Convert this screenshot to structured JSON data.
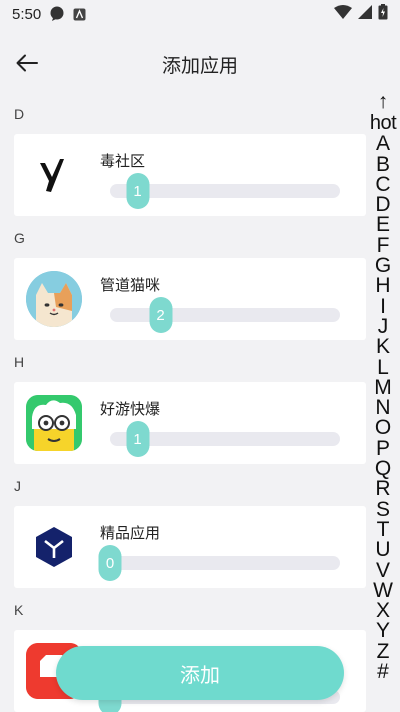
{
  "statusbar": {
    "time": "5:50"
  },
  "header": {
    "title": "添加应用"
  },
  "sections": [
    {
      "letter": "D",
      "app": {
        "name": "毒社区",
        "value": "1",
        "level": 0.12
      }
    },
    {
      "letter": "G",
      "app": {
        "name": "管道猫咪",
        "value": "2",
        "level": 0.22
      }
    },
    {
      "letter": "H",
      "app": {
        "name": "好游快爆",
        "value": "1",
        "level": 0.12
      }
    },
    {
      "letter": "J",
      "app": {
        "name": "精品应用",
        "value": "0",
        "level": 0.0
      }
    },
    {
      "letter": "K",
      "app": {
        "name": "",
        "value": "",
        "level": 0.0
      }
    }
  ],
  "index_bar": [
    "↑",
    "hot",
    "A",
    "B",
    "C",
    "D",
    "E",
    "F",
    "G",
    "H",
    "I",
    "J",
    "K",
    "L",
    "M",
    "N",
    "O",
    "P",
    "Q",
    "R",
    "S",
    "T",
    "U",
    "V",
    "W",
    "X",
    "Y",
    "Z",
    "#"
  ],
  "add_button": {
    "label": "添加"
  },
  "colors": {
    "accent": "#6fdace",
    "thumb": "#7ed9cf",
    "track": "#e9e9ef"
  }
}
